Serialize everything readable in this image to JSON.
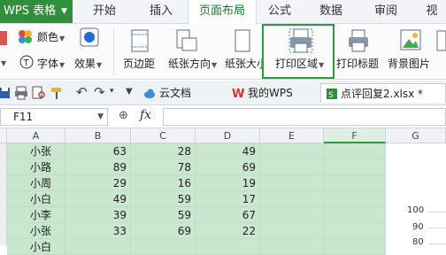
{
  "app": {
    "name": "WPS 表格"
  },
  "tabs": [
    "开始",
    "插入",
    "页面布局",
    "公式",
    "数据",
    "审阅",
    "视"
  ],
  "active_tab": "页面布局",
  "ribbon": {
    "color_label": "颜色",
    "font_label": "字体",
    "effect_label": "效果",
    "margin_label": "页边距",
    "orientation_label": "纸张方向",
    "size_label": "纸张大小",
    "print_area_label": "打印区域",
    "print_title_label": "打印标题",
    "background_label": "背景图片"
  },
  "doc_tabs": [
    {
      "label": "云文档"
    },
    {
      "label": "我的WPS"
    },
    {
      "label": "点评回复2.xlsx *"
    }
  ],
  "formula_bar": {
    "name_box": "F11",
    "fx": "fx"
  },
  "sheet": {
    "columns": [
      "A",
      "B",
      "C",
      "D",
      "E",
      "F",
      "G"
    ],
    "selected_column": "F",
    "rows": [
      [
        "小张",
        "63",
        "28",
        "49"
      ],
      [
        "小路",
        "89",
        "78",
        "69"
      ],
      [
        "小周",
        "29",
        "16",
        "19"
      ],
      [
        "小白",
        "49",
        "59",
        "17"
      ],
      [
        "小李",
        "39",
        "59",
        "67"
      ],
      [
        "小张",
        "33",
        "69",
        "22"
      ],
      [
        "小白",
        "",
        "",
        ""
      ]
    ]
  },
  "chart_axis": [
    "100",
    "90",
    "80"
  ],
  "colors": {
    "accent": "#2e9a3e",
    "selection": "#c9e6cf"
  }
}
